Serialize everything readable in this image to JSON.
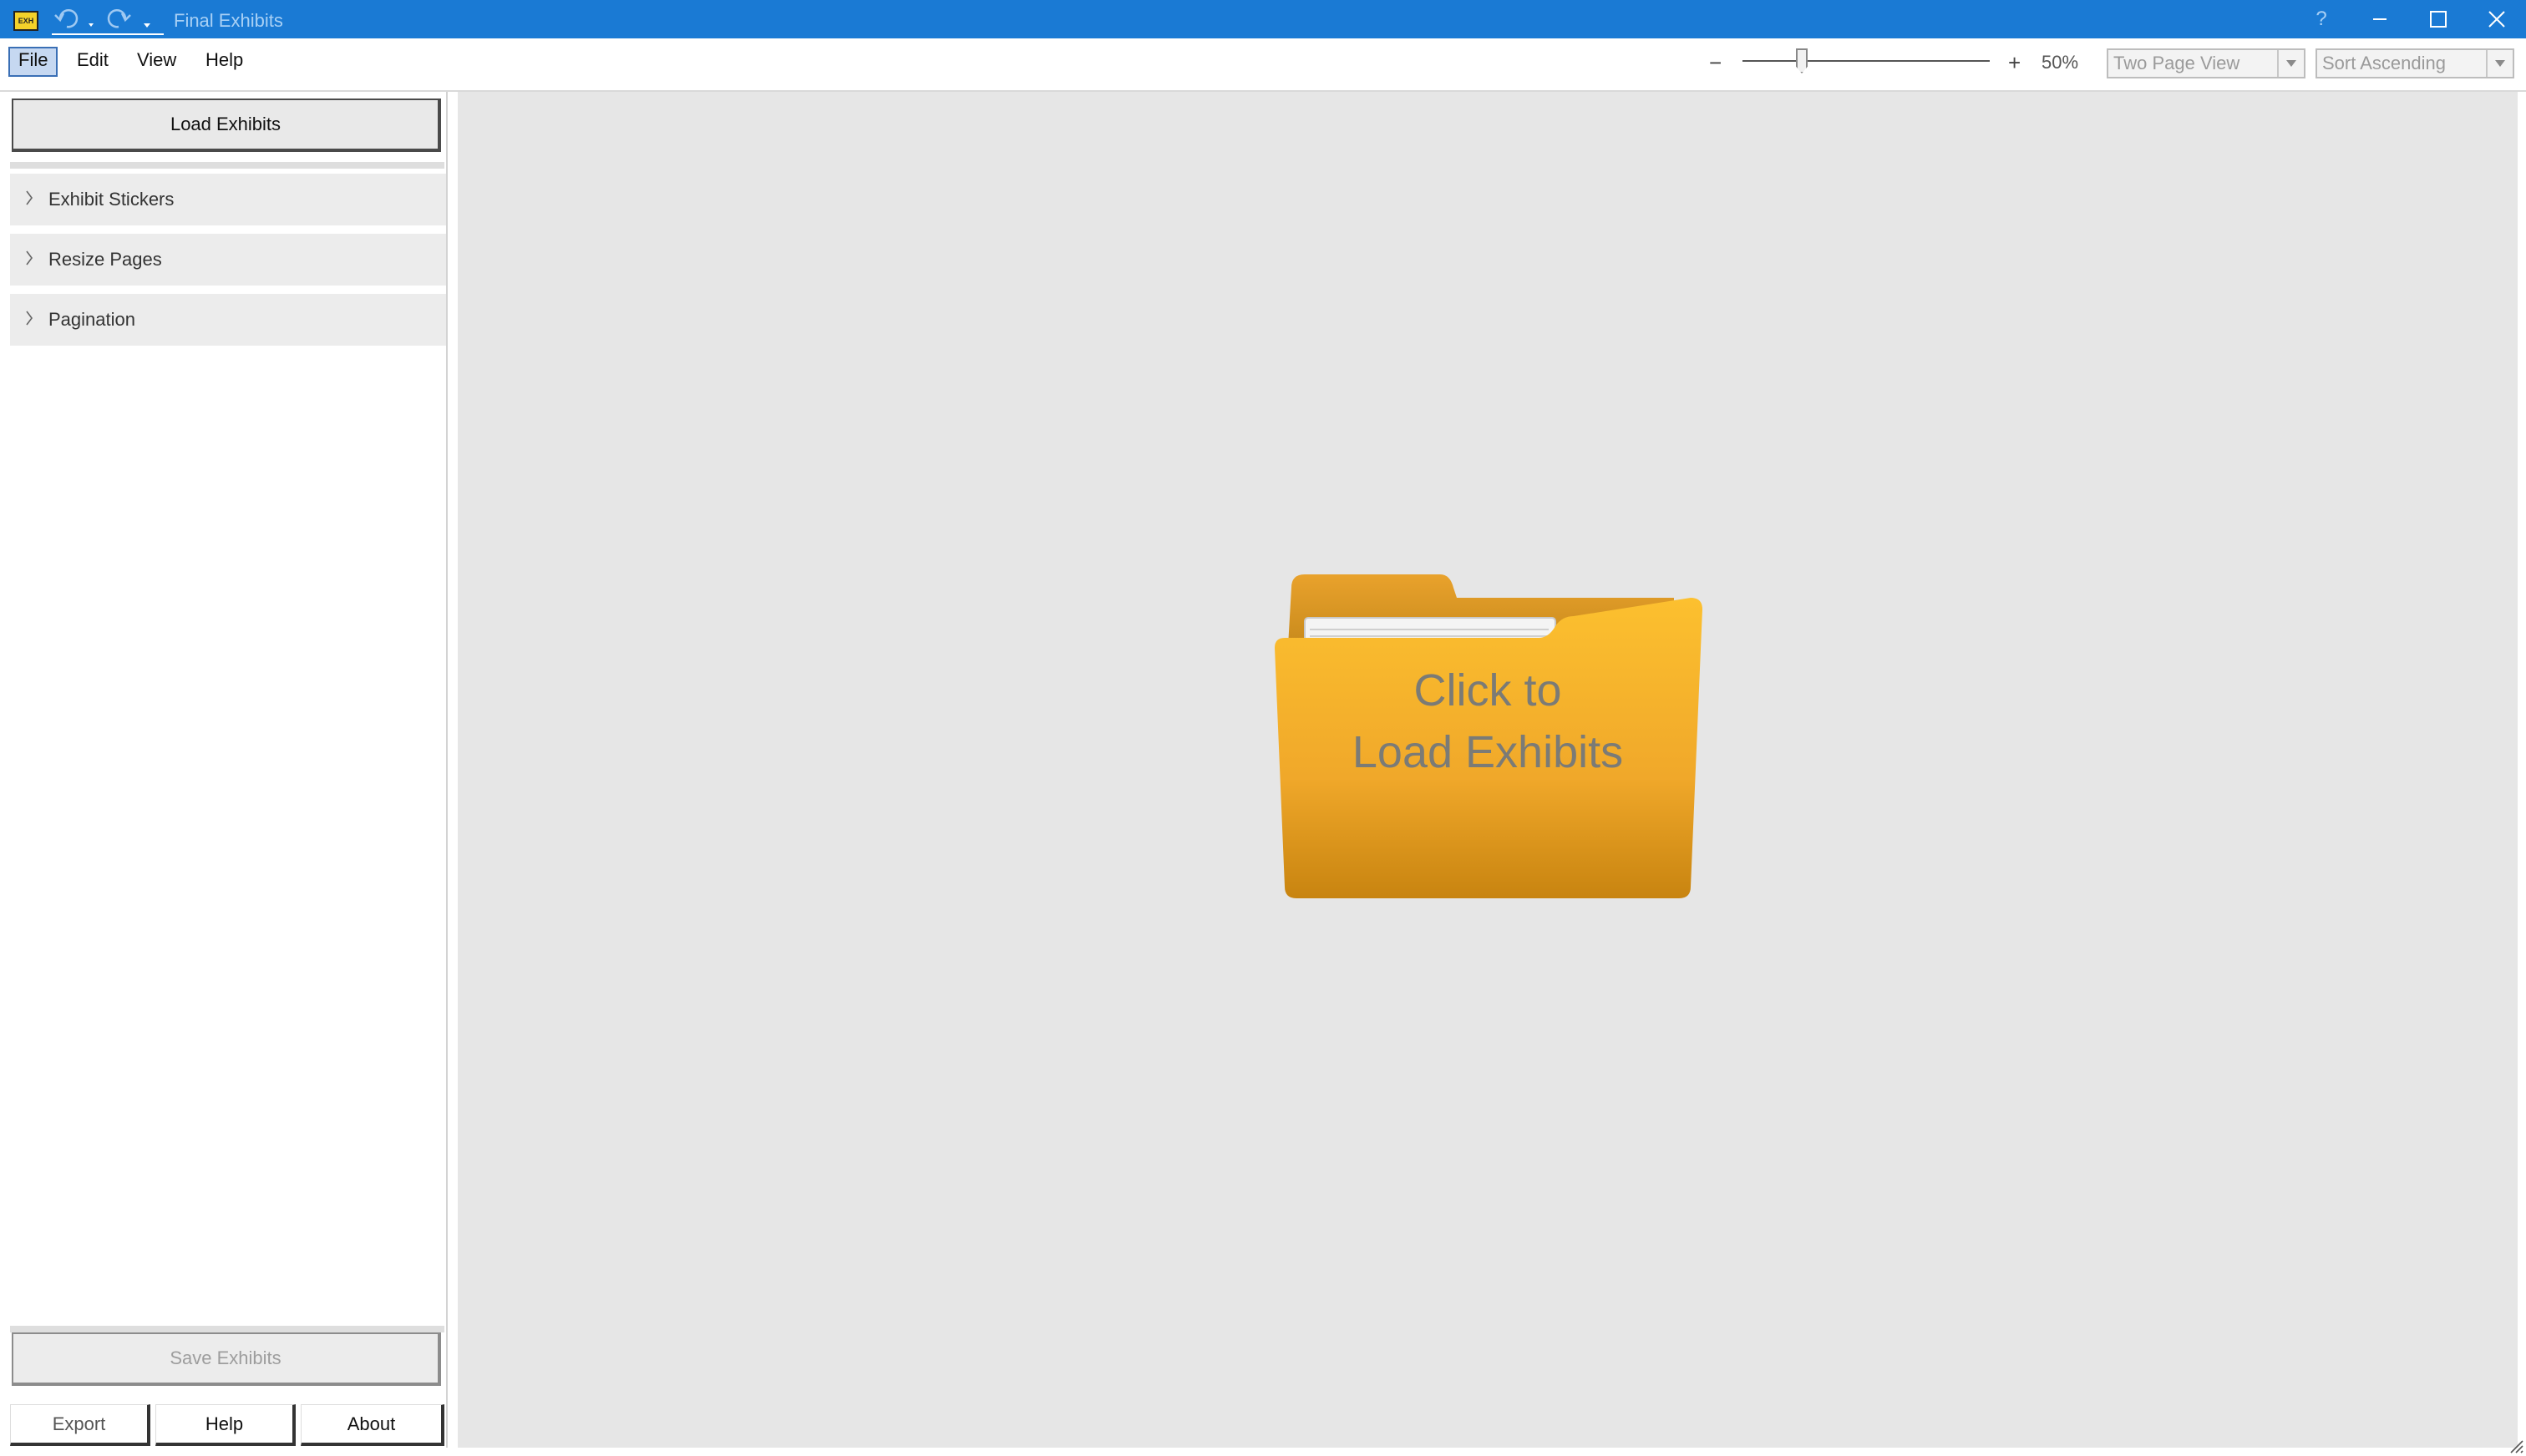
{
  "window": {
    "title": "Final Exhibits",
    "app_icon_text": "EXH",
    "help_button": "?",
    "accent_color": "#1a7ad4"
  },
  "menu": {
    "items": [
      "File",
      "Edit",
      "View",
      "Help"
    ]
  },
  "toolbar": {
    "zoom_minus": "−",
    "zoom_plus": "+",
    "zoom_label": "50%",
    "zoom_value_percent": 50,
    "view_mode": "Two Page View",
    "sort_order": "Sort Ascending"
  },
  "sidebar": {
    "load_button": "Load Exhibits",
    "sections": [
      {
        "label": "Exhibit Stickers"
      },
      {
        "label": "Resize Pages"
      },
      {
        "label": "Pagination"
      }
    ],
    "save_button": "Save Exhibits",
    "export_button": "Export",
    "help_button": "Help",
    "about_button": "About"
  },
  "main": {
    "placeholder_line1": "Click to",
    "placeholder_line2": "Load Exhibits",
    "folder_color": "#f3ac2a",
    "background_color": "#e6e6e6"
  }
}
